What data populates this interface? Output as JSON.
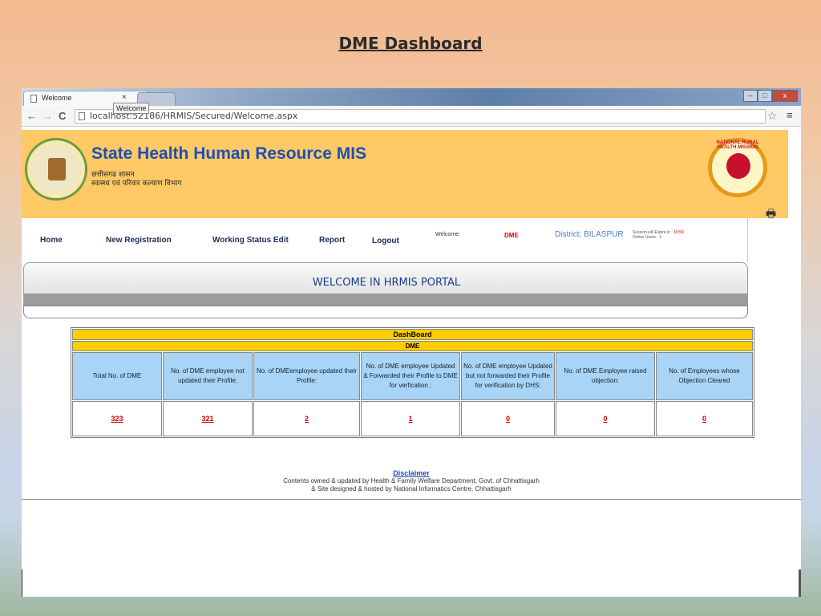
{
  "slide": {
    "title": "DME Dashboard"
  },
  "browser": {
    "tab_title": "Welcome",
    "tab_close": "×",
    "tooltip": "Welcome",
    "url": "localhost:52186/HRMIS/Secured/Welcome.aspx",
    "window_buttons": {
      "minimize": "–",
      "maximize": "□",
      "close": "x"
    }
  },
  "header": {
    "title": "State Health Human Resource MIS",
    "subtitle_line1": "छत्तीसगढ शासन",
    "subtitle_line2": "स्वास्थ्य एवं परिवार कल्याण विभाग",
    "nrhm_text": "NATIONAL RURAL HEALTH MISSION"
  },
  "nav": {
    "home": "Home",
    "new_registration": "New Registration",
    "working_status_edit": "Working Status Edit",
    "report": "Report",
    "logout": "Logout",
    "welcome_label": "Welcome:",
    "user": "DME",
    "district": "District: BILASPUR",
    "session_expire": "Session will Expire in :",
    "session_time": "19:59",
    "online_users": "Online Users : 1"
  },
  "banner": {
    "text": "WELCOME IN HRMIS PORTAL"
  },
  "dashboard": {
    "title": "DashBoard",
    "subtitle": "DME",
    "columns": [
      "Total No. of DME",
      "No. of   DME employee not  updated their Profile:",
      "No. of DMEemployee updated their Profile:",
      "No. of DME employee Updated & Forwarded their Profile to DME for verfication :",
      "No. of DME employee Updated but  not forwarded their Profile for verification by DHS:",
      "No. of DME Employee raised objection:",
      "No. of Employees whose Objection Cleared"
    ],
    "values": [
      "323",
      "321",
      "2",
      "1",
      "0",
      "0",
      "0"
    ]
  },
  "footer": {
    "disclaimer": "Disclaimer",
    "line1": "Contents owned & updated by Health & Family Welfare Department, Govt. of Chhattisgarh",
    "line2": "& Site designed & hosted by National Informatics Centre, Chhattisgarh"
  }
}
